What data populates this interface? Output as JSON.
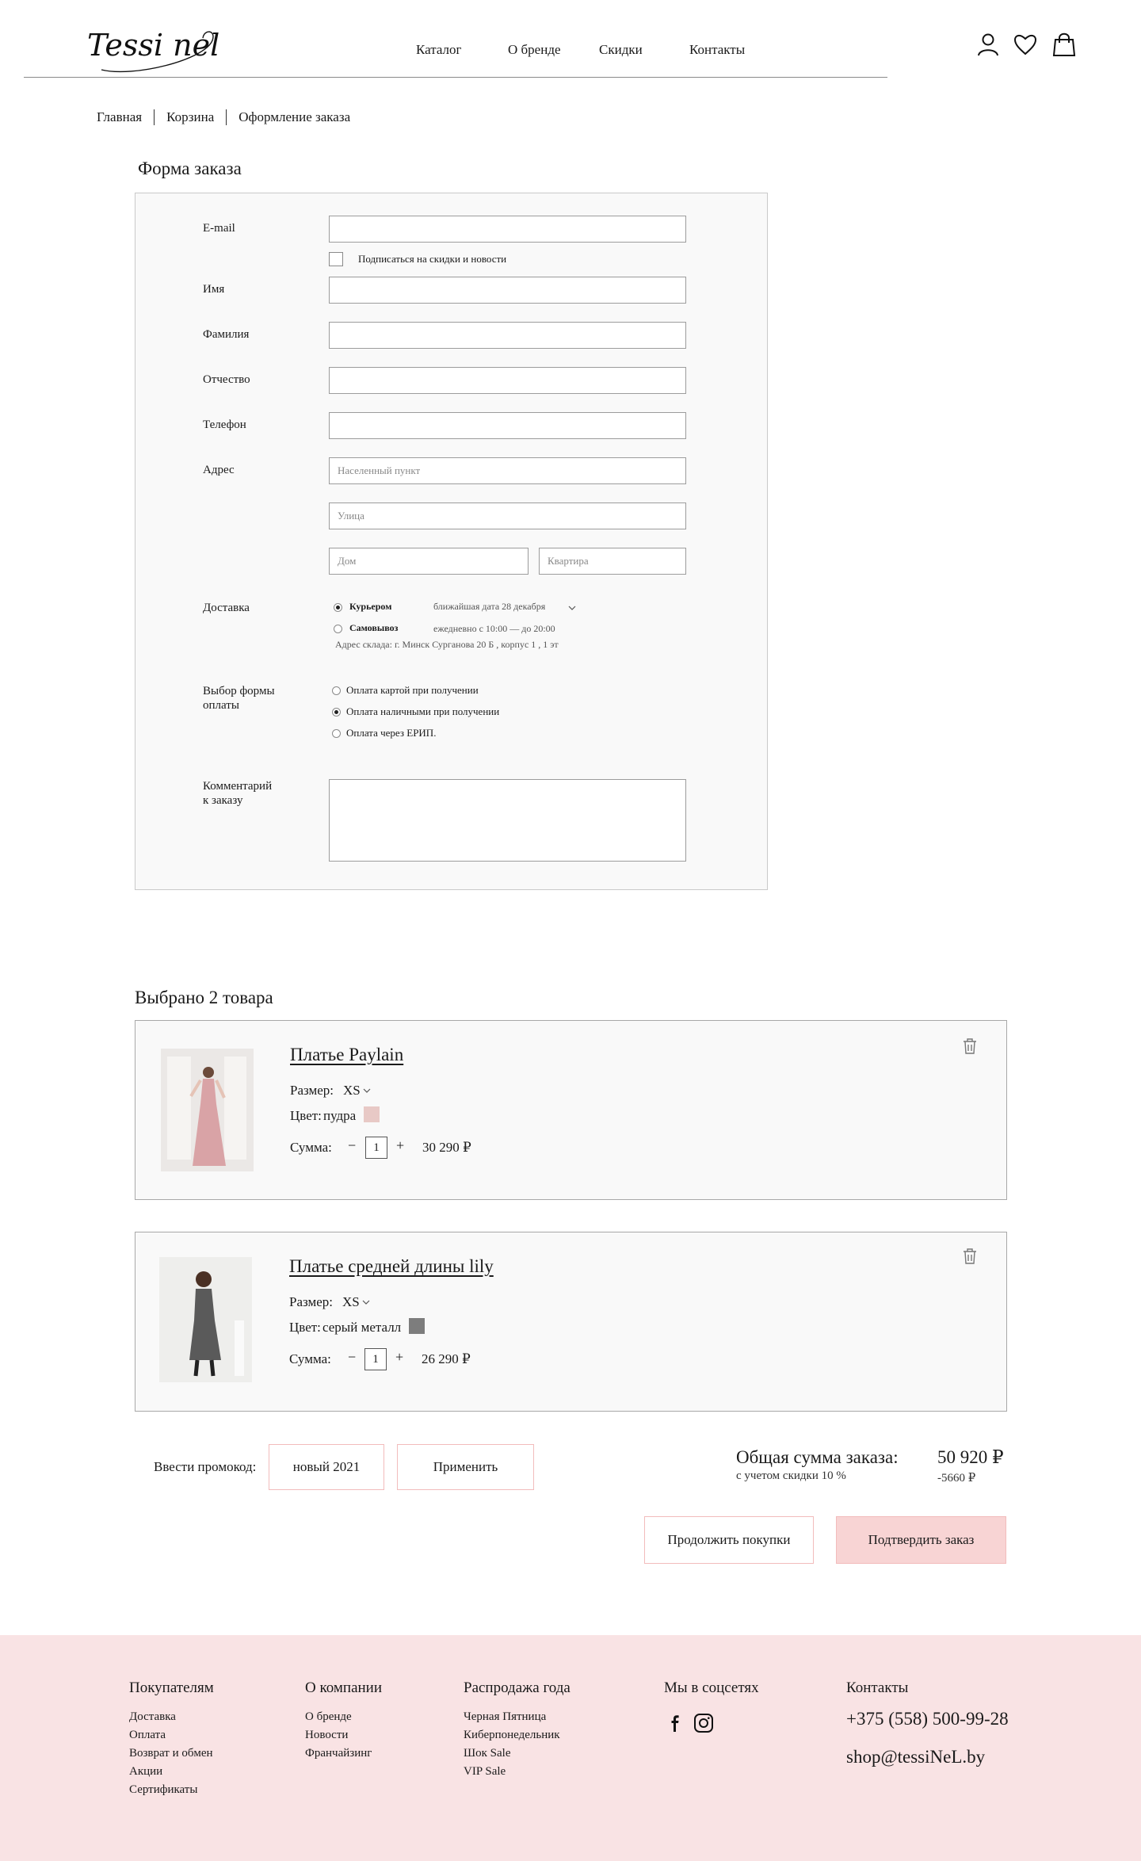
{
  "header": {
    "logo_text": "Tessi nel",
    "nav": [
      "Каталог",
      "О бренде",
      "Скидки",
      "Контакты"
    ]
  },
  "breadcrumb": [
    "Главная",
    "Корзина",
    "Оформление заказа"
  ],
  "form": {
    "title": "Форма заказа",
    "email_label": "E-mail",
    "subscribe_label": "Подписаться на скидки и новости",
    "first_name_label": "Имя",
    "last_name_label": "Фамилия",
    "patronymic_label": "Отчество",
    "phone_label": "Телефон",
    "address_label": "Адрес",
    "city_placeholder": "Населенный пункт",
    "street_placeholder": "Улица",
    "house_placeholder": "Дом",
    "flat_placeholder": "Квартира",
    "delivery_label": "Доставка",
    "delivery_options": [
      {
        "label": "Курьером",
        "note": "ближайшая дата  28 декабря",
        "selected": true
      },
      {
        "label": "Самовывоз",
        "note": "ежедневно с 10:00 — до 20:00",
        "selected": false
      }
    ],
    "warehouse_address": "Адрес склада: г. Минск Сурганова 20 Б , корпус 1 , 1 эт",
    "payment_label_1": "Выбор формы",
    "payment_label_2": "оплаты",
    "payment_options": [
      {
        "label": "Оплата картой при получении",
        "selected": false
      },
      {
        "label": "Оплата наличными при получении",
        "selected": true
      },
      {
        "label": "Оплата  через ЕРИП.",
        "selected": false
      }
    ],
    "comment_label_1": "Комментарий",
    "comment_label_2": "к заказу"
  },
  "cart": {
    "title": "Выбрано 2 товара",
    "size_label": "Размер:",
    "color_label": "Цвет:",
    "sum_label": "Сумма:",
    "items": [
      {
        "name": "Платье Paylain",
        "size": "XS",
        "color": "пудра",
        "swatch": "#e8c9c6",
        "qty": "1",
        "price": "30 290 ₽"
      },
      {
        "name": "Платье средней длины lily",
        "size": "XS",
        "color": "серый металл",
        "swatch": "#7d7d7d",
        "qty": "1",
        "price": "26 290 ₽"
      }
    ]
  },
  "promo": {
    "label": "Ввести промокод:",
    "value": "новый 2021",
    "apply": "Применить"
  },
  "totals": {
    "label": "Общая сумма заказа:",
    "note": "с учетом скидки 10 %",
    "value": "50 920 ₽",
    "discount": "-5660 ₽"
  },
  "actions": {
    "continue": "Продолжить покупки",
    "confirm": "Подтвердить заказ"
  },
  "footer": {
    "buyers": {
      "title": "Покупателям",
      "items": [
        "Доставка",
        "Оплата",
        "Возврат и обмен",
        "Акции",
        "Сертификаты"
      ]
    },
    "company": {
      "title": "О компании",
      "items": [
        "О бренде",
        "Новости",
        "Франчайзинг"
      ]
    },
    "sale": {
      "title": "Распродажа года",
      "items": [
        "Черная Пятница",
        "Киберпонедельник",
        "Шок Sale",
        "VIP Sale"
      ]
    },
    "social": {
      "title": "Мы в соцсетях"
    },
    "contacts": {
      "title": "Контакты",
      "phone": "+375 (558) 500-99-28",
      "email": "shop@tessiNeL.by"
    }
  },
  "colors": {
    "accent_pink": "#f8d4d4",
    "border_pink": "#f2bcbc",
    "footer_bg": "#f9e3e4"
  }
}
